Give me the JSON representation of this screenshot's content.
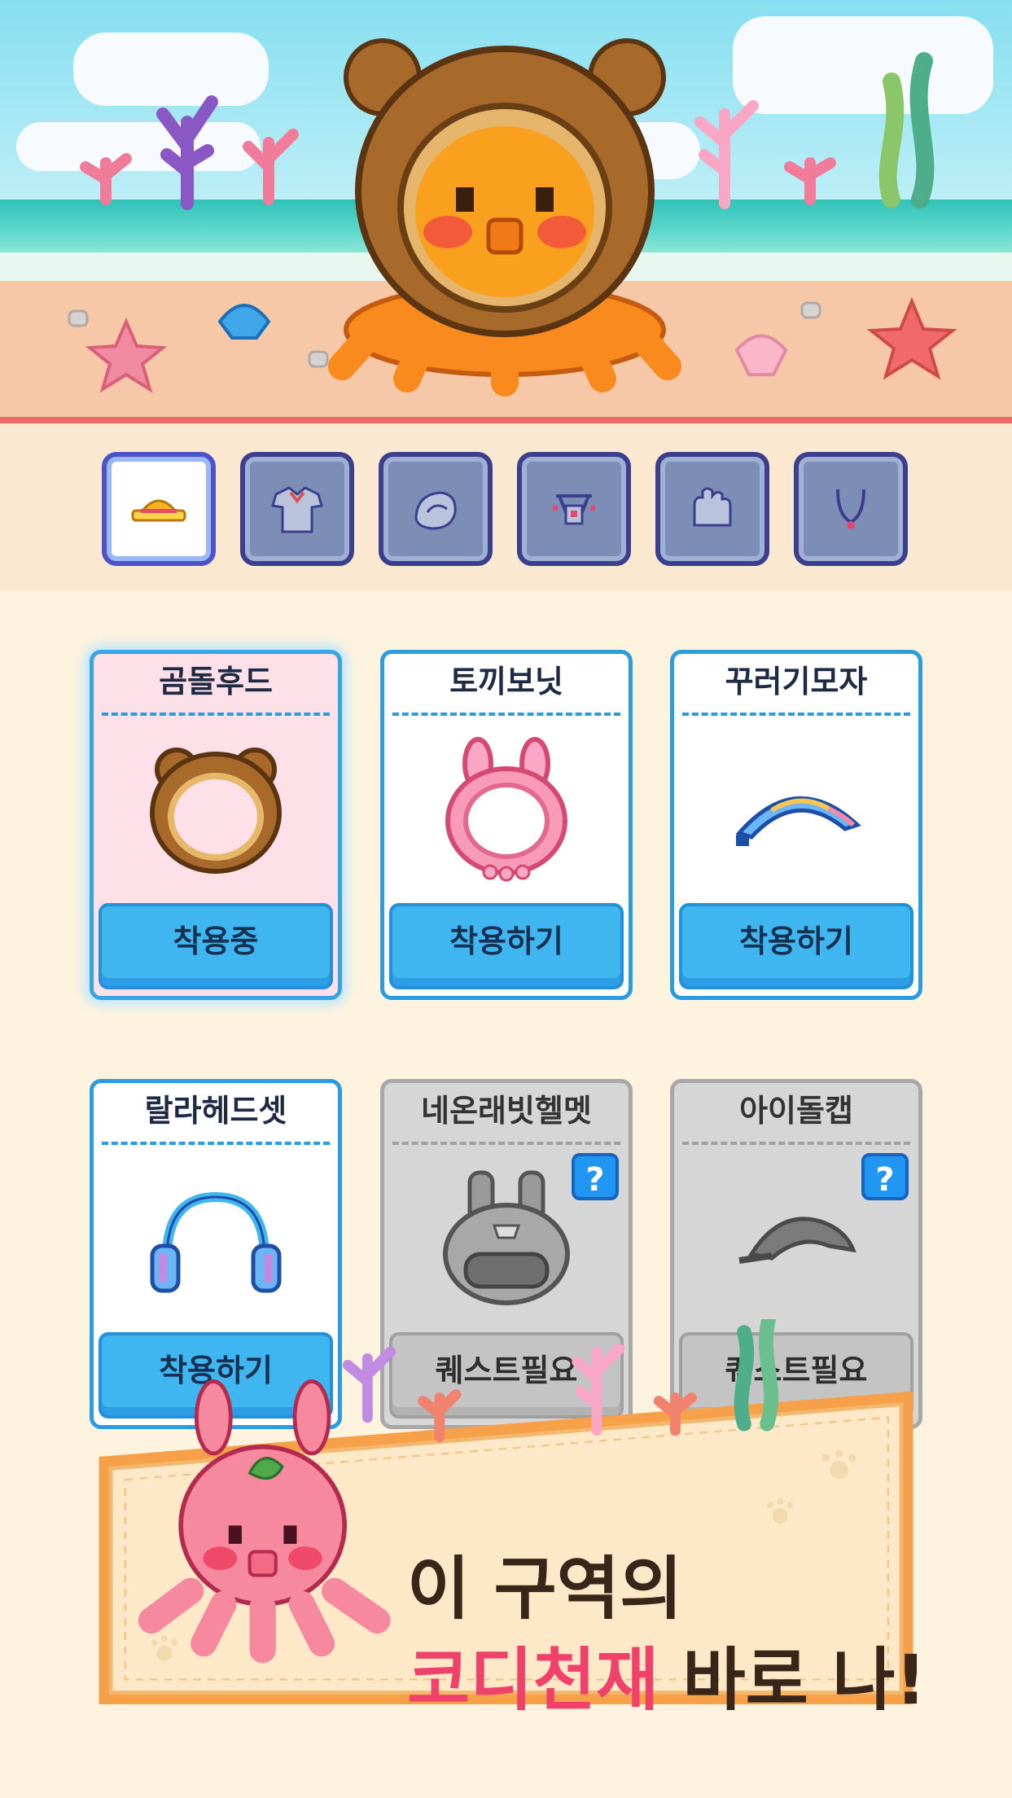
{
  "scene": {
    "area": "beach"
  },
  "tabs": [
    {
      "name": "hat-icon",
      "active": true
    },
    {
      "name": "shirt-icon",
      "active": false
    },
    {
      "name": "bag-icon",
      "active": false
    },
    {
      "name": "accessory-icon",
      "active": false
    },
    {
      "name": "gloves-icon",
      "active": false
    },
    {
      "name": "necklace-icon",
      "active": false
    }
  ],
  "items": [
    {
      "name": "곰돌후드",
      "button": "착용중",
      "state": "equipped"
    },
    {
      "name": "토끼보닛",
      "button": "착용하기",
      "state": "available"
    },
    {
      "name": "꾸러기모자",
      "button": "착용하기",
      "state": "available"
    },
    {
      "name": "랄라헤드셋",
      "button": "착용하기",
      "state": "available"
    },
    {
      "name": "네온래빗헬멧",
      "button": "퀘스트필요",
      "state": "locked",
      "badge": "?"
    },
    {
      "name": "아이돌캡",
      "button": "퀘스트필요",
      "state": "locked",
      "badge": "?"
    }
  ],
  "banner": {
    "line1": "이 구역의",
    "highlight": "코디천재",
    "line2_rest": " 바로 나!"
  },
  "colors": {
    "highlight": "#f0416b",
    "card_border": "#2a9ce0",
    "button": "#3fb6f0",
    "equipped_bg": "#fde0e8",
    "locked_bg": "#d6d6d6"
  }
}
